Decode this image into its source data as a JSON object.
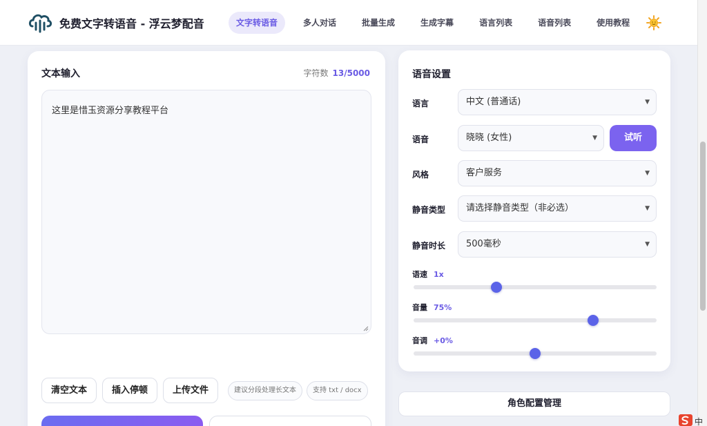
{
  "header": {
    "title": "免费文字转语音 - 浮云梦配音",
    "logo_icon": "sound-wave-cloud-icon",
    "nav": [
      {
        "label": "文字转语音",
        "active": true
      },
      {
        "label": "多人对话",
        "active": false
      },
      {
        "label": "批量生成",
        "active": false
      },
      {
        "label": "生成字幕",
        "active": false
      },
      {
        "label": "语言列表",
        "active": false
      },
      {
        "label": "语音列表",
        "active": false
      },
      {
        "label": "使用教程",
        "active": false
      }
    ],
    "theme_icon": "sun-icon"
  },
  "text_input": {
    "title": "文本输入",
    "char_count_label": "字符数",
    "char_count_value": "13/5000",
    "text": "这里是惜玉资源分享教程平台",
    "buttons": {
      "clear": "清空文本",
      "insert_pause": "插入停顿",
      "upload": "上传文件"
    },
    "chips": {
      "tip": "建议分段处理长文本",
      "formats": "支持 txt / docx"
    }
  },
  "voice_settings": {
    "title": "语音设置",
    "language_label": "语言",
    "language_value": "中文 (普通话)",
    "voice_label": "语音",
    "voice_value": "晓晓 (女性)",
    "listen_button": "试听",
    "style_label": "风格",
    "style_value": "客户服务",
    "silence_type_label": "静音类型",
    "silence_type_value": "请选择静音类型（非必选）",
    "silence_duration_label": "静音时长",
    "silence_duration_value": "500毫秒",
    "speed_label": "语速",
    "speed_value": "1x",
    "speed_fraction": 0.34,
    "volume_label": "音量",
    "volume_value": "75%",
    "volume_fraction": 0.74,
    "pitch_label": "音调",
    "pitch_value": "+0%",
    "pitch_fraction": 0.5
  },
  "role_manage_button": "角色配置管理",
  "corner": {
    "text": "中"
  },
  "colors": {
    "accent": "#6a5be4",
    "button_primary": "#7b63ef",
    "slider_thumb": "#5b63e8"
  }
}
